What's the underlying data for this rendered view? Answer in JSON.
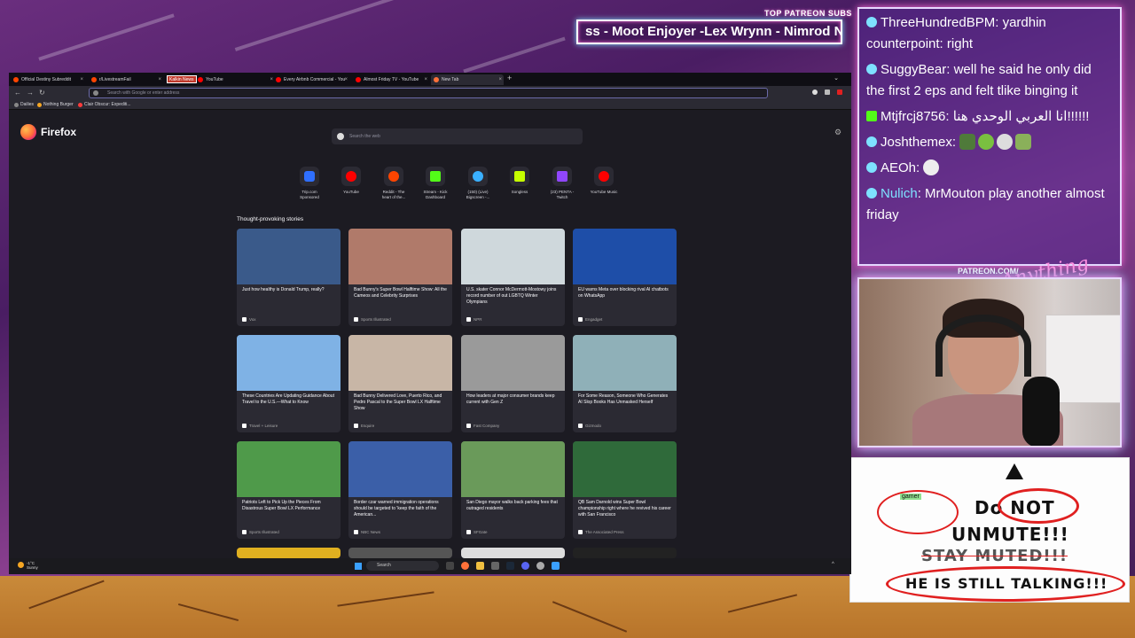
{
  "patreon": {
    "title": "TOP PATREON SUBS",
    "ticker": "ss - Moot Enjoyer -Lex Wrynn - Nimrod Nir"
  },
  "chat": {
    "messages": [
      {
        "user": "ThreeHundredBPM",
        "text": "yardhin counterpoint: right",
        "color": "#ffffff"
      },
      {
        "user": "SuggyBear",
        "text": "well he said he only did the first 2 eps and felt tlike binging it",
        "color": "#ffffff"
      },
      {
        "user": "Mtjfrcj8756",
        "text": "انا العربي الوحدي هنا!!!!!!",
        "color": "#ffffff"
      },
      {
        "user": "Joshthemex",
        "text": "",
        "color": "#ffffff"
      },
      {
        "user": "AEOh",
        "text": "",
        "color": "#ffffff"
      },
      {
        "user": "Nulich",
        "text": "MrMouton play another almost friday",
        "color": "#7ee1ff"
      }
    ]
  },
  "webcam": {
    "label": "PATREON.COM/",
    "signature": "Anything Else"
  },
  "note": {
    "line1": "Do NOT",
    "line2": "UNMUTE!!!",
    "line3": "STAY MUTED!!!",
    "line4": "HE IS STILL TALKING!!!",
    "tag": "gamer"
  },
  "browser": {
    "tabs": [
      {
        "label": "Official Destiny Subreddit",
        "fav": "#ff4500",
        "active": false
      },
      {
        "label": "r/LivestreamFail",
        "fav": "#ff4500",
        "active": false
      },
      {
        "label": "YouTube",
        "fav": "#ff0000",
        "active": false
      },
      {
        "label": "Every Airbnb Commercial - You",
        "fav": "#ff0000",
        "active": false
      },
      {
        "label": "Almost Friday TV - YouTube",
        "fav": "#ff0000",
        "active": false
      },
      {
        "label": "New Tab",
        "fav": "#ff7139",
        "active": true
      }
    ],
    "tab_badge": "Kalkin News",
    "url_placeholder": "Search with Google or enter address",
    "bookmarks": [
      {
        "label": "Dailies",
        "color": "#888"
      },
      {
        "label": "Nothing Burger",
        "color": "#f5a623"
      },
      {
        "label": "Clair Obscur: Expediti...",
        "color": "#ff3b3b"
      }
    ],
    "logo_text": "Firefox",
    "search_placeholder": "Search the web",
    "shortcuts": [
      {
        "label": "Trip.com\nSponsored",
        "color": "#2f6fff",
        "icon": "Trip."
      },
      {
        "label": "YouTube",
        "color": "#ff0000",
        "icon": ""
      },
      {
        "label": "Reddit - The heart of the...",
        "color": "#ff4500",
        "icon": ""
      },
      {
        "label": "Stream - Kick Dashboard",
        "color": "#53fc18",
        "icon": "K"
      },
      {
        "label": "(150) (Live) Bigscreen -...",
        "color": "#3ab0ff",
        "icon": ""
      },
      {
        "label": "Songless",
        "color": "#c6ff00",
        "icon": ""
      },
      {
        "label": "(23) PENTA - Twitch",
        "color": "#9146ff",
        "icon": ""
      },
      {
        "label": "YouTube Music",
        "color": "#ff0000",
        "icon": ""
      }
    ],
    "stories_title": "Thought-provoking stories",
    "stories": [
      {
        "title": "Just how healthy is Donald Trump, really?",
        "source": "Vox",
        "img": "#3a5a8a"
      },
      {
        "title": "Bad Bunny's Super Bowl Halftime Show: All the Cameos and Celebrity Surprises",
        "source": "Sports Illustrated",
        "img": "#b07a6a"
      },
      {
        "title": "U.S. skater Connor McDermott-Mostowy joins record number of out LGBTQ Winter Olympians",
        "source": "NPR",
        "img": "#cfd8dc"
      },
      {
        "title": "EU warns Meta over blocking rival AI chatbots on WhatsApp",
        "source": "Engadget",
        "img": "#1e4ea8"
      },
      {
        "title": "These Countries Are Updating Guidance About Travel to the U.S.—What to Know",
        "source": "Travel + Leisure",
        "img": "#7fb2e5"
      },
      {
        "title": "Bad Bunny Delivered Love, Puerto Rico, and Pedro Pascal to the Super Bowl LX Halftime Show",
        "source": "Esquire",
        "img": "#c8b6a6"
      },
      {
        "title": "How leaders at major consumer brands keep current with Gen Z",
        "source": "Fast Company",
        "img": "#9a9a9a"
      },
      {
        "title": "For Some Reason, Someone Who Generates AI Slop Books Has Unmasked Herself",
        "source": "Gizmodo",
        "img": "#8fb0b8"
      },
      {
        "title": "Patriots Left to Pick Up the Pieces From Disastrous Super Bowl LX Performance",
        "source": "Sports Illustrated",
        "img": "#4f9a4a"
      },
      {
        "title": "Border czar warned immigration operations should be targeted to 'keep the faith of the American...",
        "source": "NBC News",
        "img": "#3b5fa8"
      },
      {
        "title": "San Diego mayor walks back parking fees that outraged residents",
        "source": "SFGate",
        "img": "#6a9a5a"
      },
      {
        "title": "QB Sam Darnold wins Super Bowl championship right where he revived his career with San Francisco",
        "source": "The Associated Press",
        "img": "#2f6a3a"
      }
    ],
    "taskbar": {
      "weather_temp": "-1°C",
      "weather_desc": "Sunny",
      "search_label": "Search"
    }
  }
}
